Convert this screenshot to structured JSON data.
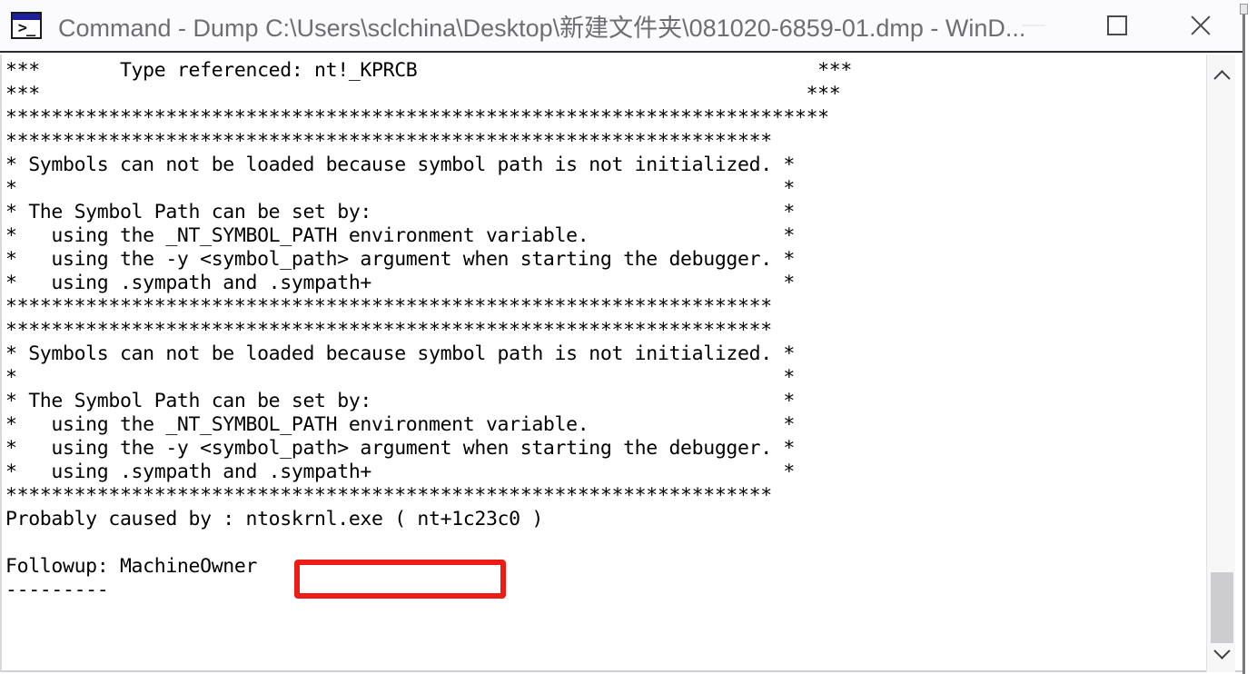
{
  "window": {
    "title": "Command - Dump C:\\Users\\sclchina\\Desktop\\新建文件夹\\081020-6859-01.dmp - WinD...",
    "icon_glyph": ">_",
    "icon_name": "console-app-icon",
    "controls": {
      "minimize_label": "Minimize",
      "maximize_label": "Maximize",
      "close_label": "Close"
    },
    "title_color": "#6d6d74",
    "accent_color": "#1f1f9e"
  },
  "console": {
    "font": "monospace",
    "text_color": "#000000",
    "background_color": "#ffffff",
    "lines": [
      "***       Type referenced: nt!_KPRCB                                   ***",
      "***                                                                   ***",
      "************************************************************************",
      "*******************************************************************",
      "* Symbols can not be loaded because symbol path is not initialized. *",
      "*                                                                   *",
      "* The Symbol Path can be set by:                                    *",
      "*   using the _NT_SYMBOL_PATH environment variable.                 *",
      "*   using the -y <symbol_path> argument when starting the debugger. *",
      "*   using .sympath and .sympath+                                    *",
      "*******************************************************************",
      "*******************************************************************",
      "* Symbols can not be loaded because symbol path is not initialized. *",
      "*                                                                   *",
      "* The Symbol Path can be set by:                                    *",
      "*   using the _NT_SYMBOL_PATH environment variable.                 *",
      "*   using the -y <symbol_path> argument when starting the debugger. *",
      "*   using .sympath and .sympath+                                    *",
      "*******************************************************************",
      "Probably caused by : ntoskrnl.exe ( nt+1c23c0 )",
      "",
      "Followup: MachineOwner",
      "---------"
    ]
  },
  "highlight": {
    "name": "ntoskrnl-highlight-box",
    "target_text": "ntoskrnl.exe",
    "color": "#ee1c16"
  },
  "scrollbar": {
    "up_arrow_label": "Scroll up",
    "down_arrow_label": "Scroll down",
    "thumb_label": "Scroll thumb",
    "track_color": "#f7f7f8",
    "thumb_color": "#cdcdd1"
  }
}
